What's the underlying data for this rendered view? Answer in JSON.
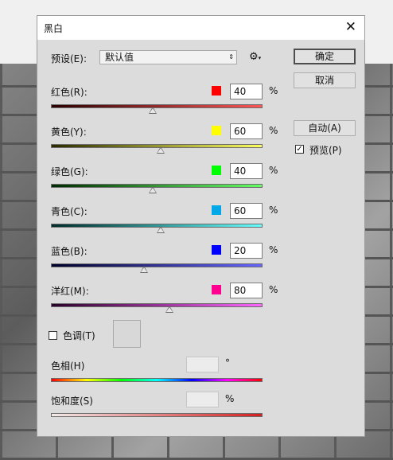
{
  "dialog": {
    "title": "黑白",
    "close_glyph": "✕"
  },
  "preset": {
    "label": "预设(E):",
    "value": "默认值",
    "arrow": "⇕",
    "gear_glyph": "⚙",
    "gear_caret": "▾"
  },
  "buttons": {
    "ok": "确定",
    "cancel": "取消",
    "auto": "自动(A)"
  },
  "preview": {
    "label": "预览(P)",
    "checked": true,
    "check_glyph": "✓"
  },
  "sliders": [
    {
      "label": "红色(R):",
      "value": "40",
      "unit": "%",
      "color": "#ff0000",
      "percent": 48,
      "gradient": [
        "#2a0000",
        "#ff5555"
      ]
    },
    {
      "label": "黄色(Y):",
      "value": "60",
      "unit": "%",
      "color": "#ffff00",
      "percent": 52,
      "gradient": [
        "#2a2a00",
        "#ffff60"
      ]
    },
    {
      "label": "绿色(G):",
      "value": "40",
      "unit": "%",
      "color": "#00ff00",
      "percent": 48,
      "gradient": [
        "#002a00",
        "#66ff66"
      ]
    },
    {
      "label": "青色(C):",
      "value": "60",
      "unit": "%",
      "color": "#00a8e8",
      "percent": 52,
      "gradient": [
        "#002a2a",
        "#66ffff"
      ]
    },
    {
      "label": "蓝色(B):",
      "value": "20",
      "unit": "%",
      "color": "#0000ff",
      "percent": 44,
      "gradient": [
        "#00002a",
        "#6666ff"
      ]
    },
    {
      "label": "洋红(M):",
      "value": "80",
      "unit": "%",
      "color": "#ff0090",
      "percent": 56,
      "gradient": [
        "#2a002a",
        "#ff66ff"
      ]
    }
  ],
  "tint": {
    "label": "色调(T)",
    "checked": false
  },
  "hue": {
    "label": "色相(H)",
    "unit": "°"
  },
  "saturation": {
    "label": "饱和度(S)",
    "unit": "%"
  }
}
